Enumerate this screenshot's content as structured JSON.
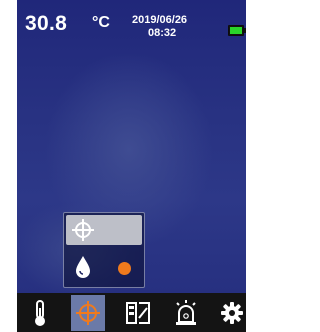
{
  "status_bar": {
    "temperature": "30.8",
    "unit": "°C",
    "date": "2019/06/26",
    "time": "08:32",
    "battery_color": "#2ad52a"
  },
  "popup": {
    "options": [
      {
        "icon": "crosshair-icon",
        "selected": true
      },
      {
        "icon": "water-drop-icon",
        "indicator_color": "#ef7a1d"
      }
    ]
  },
  "toolbar": {
    "items": [
      {
        "icon": "thermometer-icon"
      },
      {
        "icon": "crosshair-icon",
        "active": true
      },
      {
        "icon": "palette-icon"
      },
      {
        "icon": "alarm-icon"
      },
      {
        "icon": "settings-icon"
      }
    ],
    "active_color": "#6b7aa8",
    "accent_color": "#ef7a1d"
  }
}
